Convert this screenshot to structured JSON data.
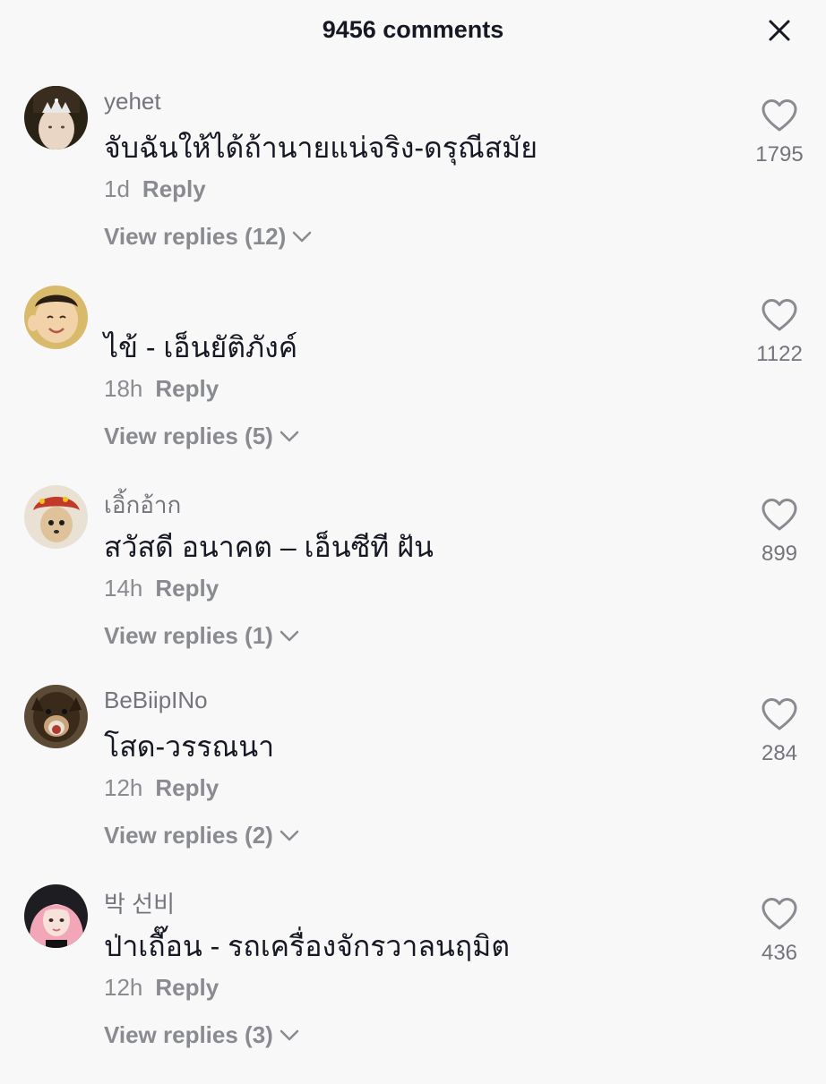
{
  "header": {
    "title": "9456 comments",
    "close_icon": "close-icon"
  },
  "comments": [
    {
      "username": "yehet",
      "text": "จับฉันให้ได้ถ้านายแน่จริง-ดรุณีสมัย",
      "time": "1d",
      "reply_label": "Reply",
      "view_replies": "View replies (12)",
      "likes": "1795"
    },
    {
      "username": "",
      "text": "ไข้ - เอ็นยัติภังค์",
      "time": "18h",
      "reply_label": "Reply",
      "view_replies": "View replies (5)",
      "likes": "1122"
    },
    {
      "username": "เอิ้กอ้าก",
      "text": "สวัสดี อนาคต – เอ็นซีที ฝัน",
      "time": "14h",
      "reply_label": "Reply",
      "view_replies": "View replies (1)",
      "likes": "899"
    },
    {
      "username": "BeBiipINo",
      "text": "โสด-วรรณนา",
      "time": "12h",
      "reply_label": "Reply",
      "view_replies": "View replies (2)",
      "likes": "284"
    },
    {
      "username": "박 선비",
      "text": "ป่าเถื๊อน - รถเครื่องจักรวาลนฤมิต",
      "time": "12h",
      "reply_label": "Reply",
      "view_replies": "View replies (3)",
      "likes": "436"
    }
  ],
  "icons": {
    "like": "heart-outline-icon",
    "expand": "chevron-down-icon"
  },
  "colors": {
    "background": "#f8f8f8",
    "primary_text": "#161823",
    "secondary_text": "#8a8b91"
  }
}
